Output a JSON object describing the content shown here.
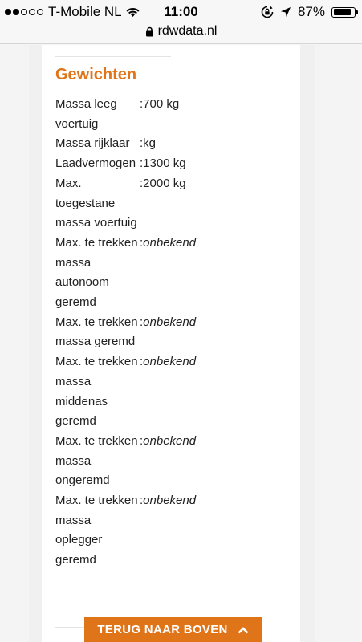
{
  "status_bar": {
    "carrier": "T-Mobile NL",
    "time": "11:00",
    "battery": "87%",
    "battery_level": 0.87,
    "signal_bars_filled": 2,
    "signal_bars_total": 5
  },
  "url_bar": {
    "url": "rdwdata.nl"
  },
  "section": {
    "title": "Gewichten",
    "separator": ":",
    "rows": [
      {
        "label": "Massa leeg voertuig",
        "value": "700 kg",
        "italic": false
      },
      {
        "label": "Massa rijklaar",
        "value": "kg",
        "italic": false
      },
      {
        "label": "Laadvermogen",
        "value": "1300 kg",
        "italic": false
      },
      {
        "label": "Max. toegestane massa voertuig",
        "value": "2000 kg",
        "italic": false
      },
      {
        "label": "Max. te trekken massa autonoom geremd",
        "value": "onbekend",
        "italic": true
      },
      {
        "label": "Max. te trekken massa geremd",
        "value": "onbekend",
        "italic": true
      },
      {
        "label": "Max. te trekken massa middenas geremd",
        "value": "onbekend",
        "italic": true
      },
      {
        "label": "Max. te trekken massa ongeremd",
        "value": "onbekend",
        "italic": true
      },
      {
        "label": "Max. te trekken massa oplegger geremd",
        "value": "onbekend",
        "italic": true
      }
    ]
  },
  "back_to_top": {
    "label": "TERUG NAAR BOVEN",
    "icon": "chevron-up-icon"
  },
  "colors": {
    "accent": "#e07418"
  }
}
